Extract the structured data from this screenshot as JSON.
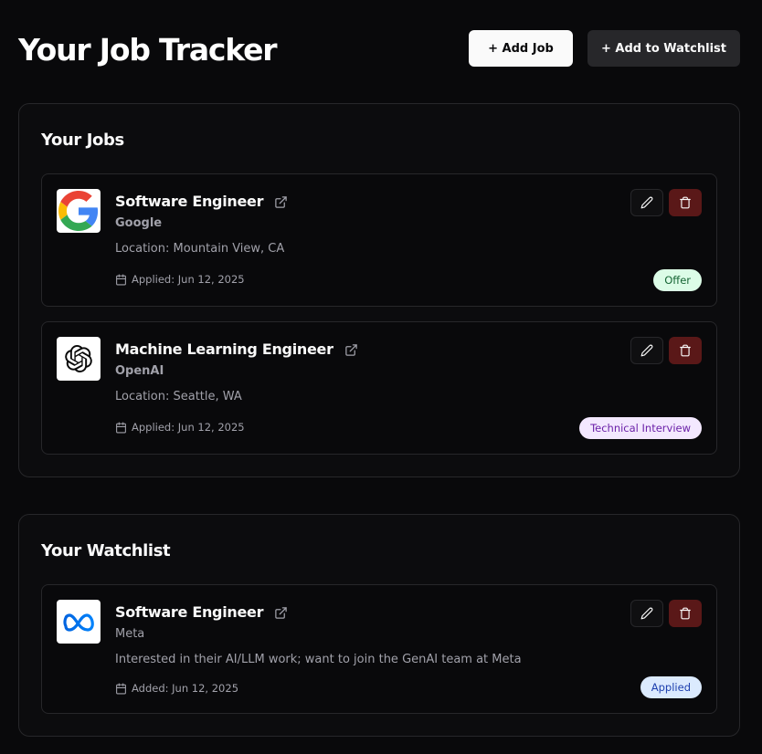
{
  "header": {
    "title": "Your Job Tracker",
    "add_job_label": "+ Add Job",
    "add_watchlist_label": "+ Add to Watchlist"
  },
  "jobs_section": {
    "title": "Your Jobs",
    "jobs": [
      {
        "title": "Software Engineer",
        "company": "Google",
        "location": "Location: Mountain View, CA",
        "date": "Applied: Jun 12, 2025",
        "status": "Offer",
        "status_bg": "#dcfce7",
        "status_color": "#166534",
        "logo": "google-logo"
      },
      {
        "title": "Machine Learning Engineer",
        "company": "OpenAI",
        "location": "Location: Seattle, WA",
        "date": "Applied: Jun 12, 2025",
        "status": "Technical Interview",
        "status_bg": "#f3e8ff",
        "status_color": "#6b21a8",
        "logo": "openai-logo"
      }
    ]
  },
  "watchlist_section": {
    "title": "Your Watchlist",
    "items": [
      {
        "title": "Software Engineer",
        "company": "Meta",
        "note": "Interested in their AI/LLM work; want to join the GenAI team at Meta",
        "date": "Added: Jun 12, 2025",
        "status": "Applied",
        "status_bg": "#dbeafe",
        "status_color": "#1e40af",
        "logo": "meta-logo"
      }
    ]
  },
  "colors": {
    "background": "#09090b",
    "delete_button": "#5a1818",
    "border": "#27272a"
  },
  "icons": [
    "external-link-icon",
    "calendar-icon",
    "pencil-icon",
    "trash-icon"
  ]
}
